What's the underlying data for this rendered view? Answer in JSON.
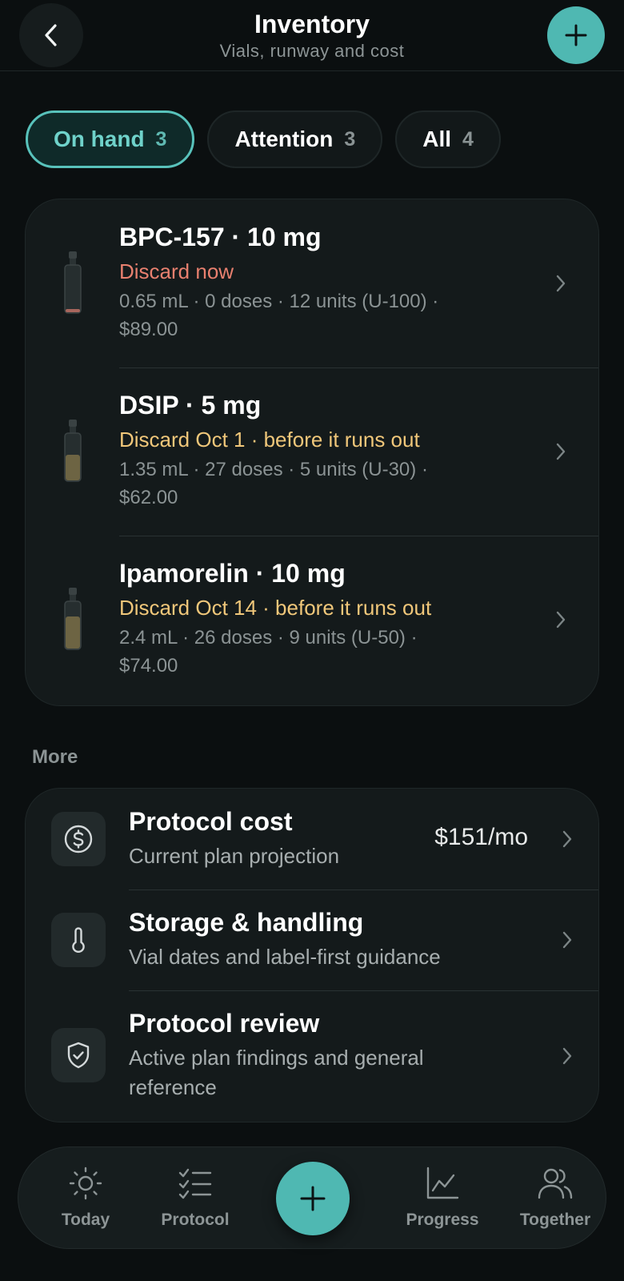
{
  "header": {
    "title": "Inventory",
    "subtitle": "Vials, runway and cost"
  },
  "filters": [
    {
      "label": "On hand",
      "count": "3",
      "active": true
    },
    {
      "label": "Attention",
      "count": "3",
      "active": false
    },
    {
      "label": "All",
      "count": "4",
      "active": false
    }
  ],
  "vials": [
    {
      "name": "BPC-157 · 10 mg",
      "status": "Discard now",
      "status_color": "#e8806f",
      "detail_line1": "0.65 mL · 0 doses · 12 units (U-100) ·",
      "detail_line2": "$89.00",
      "fill_level": 0.05
    },
    {
      "name": "DSIP · 5 mg",
      "status": "Discard Oct 1 · before it runs out",
      "status_color": "#f0c77a",
      "detail_line1": "1.35 mL · 27 doses · 5 units (U-30) ·",
      "detail_line2": "$62.00",
      "fill_level": 0.6
    },
    {
      "name": "Ipamorelin · 10 mg",
      "status": "Discard Oct 14 · before it runs out",
      "status_color": "#f0c77a",
      "detail_line1": "2.4 mL · 26 doses · 9 units (U-50) ·",
      "detail_line2": "$74.00",
      "fill_level": 0.72
    }
  ],
  "more": {
    "label": "More",
    "items": [
      {
        "title": "Protocol cost",
        "subtitle": "Current plan projection",
        "value": "$151/mo",
        "icon": "dollar-circle-icon"
      },
      {
        "title": "Storage & handling",
        "subtitle": "Vial dates and label-first guidance",
        "icon": "thermometer-icon"
      },
      {
        "title": "Protocol review",
        "subtitle_line1": "Active plan findings and general",
        "subtitle_line2": "reference",
        "icon": "shield-check-icon"
      }
    ]
  },
  "nav": {
    "today": "Today",
    "protocol": "Protocol",
    "progress": "Progress",
    "together": "Together"
  },
  "colors": {
    "accent": "#4fb8b2",
    "background": "#0b0f10",
    "card": "#141a1b"
  }
}
